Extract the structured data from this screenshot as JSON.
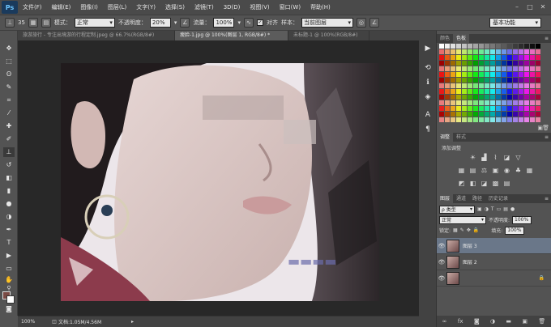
{
  "app": {
    "logo": "Ps"
  },
  "menu": [
    "文件(F)",
    "编辑(E)",
    "图像(I)",
    "图层(L)",
    "文字(Y)",
    "选择(S)",
    "滤镜(T)",
    "3D(D)",
    "视图(V)",
    "窗口(W)",
    "帮助(H)"
  ],
  "window_controls": [
    "–",
    "□",
    "✕"
  ],
  "options": {
    "brush_size": "35",
    "mode_label": "模式：",
    "mode_value": "正常",
    "opacity_label": "不透明度：",
    "opacity_value": "20%",
    "flow_label": "流量：",
    "flow_value": "100%",
    "aligned_label": "对齐",
    "sample_label": "样本：",
    "sample_value": "当前图层",
    "workspace": "基本功能"
  },
  "tabs": [
    {
      "label": "旅游旅行 - 专注出境游的行程定制.jpeg @ 66.7%(RGB/8#)",
      "active": false
    },
    {
      "label": "瘦脸-1.jpg @ 100%(图层 1, RGB/8#) *",
      "active": true
    },
    {
      "label": "未标题-1 @ 100%(RGB/8#)",
      "active": false
    }
  ],
  "status": {
    "zoom": "100%",
    "doc": "文档:1.05M/4.56M"
  },
  "panels": {
    "color_tabs": [
      "颜色",
      "色板"
    ],
    "adjust_tabs": [
      "调整",
      "样式"
    ],
    "adjust_title": "添加调整",
    "layers_tabs": [
      "图层",
      "通道",
      "路径",
      "历史记录"
    ],
    "filter_kind": "ρ 类型",
    "blend_mode": "正常",
    "opacity_label": "不透明度:",
    "opacity_value": "100%",
    "lock_label": "锁定:",
    "fill_label": "填充:",
    "fill_value": "100%",
    "layers": [
      {
        "name": "图层 3",
        "selected": true
      },
      {
        "name": "图层 2",
        "selected": false
      }
    ]
  },
  "colors": {
    "accent_selected": "#6a7789",
    "foreground": "#7a4a44",
    "background": "#ffffff"
  }
}
